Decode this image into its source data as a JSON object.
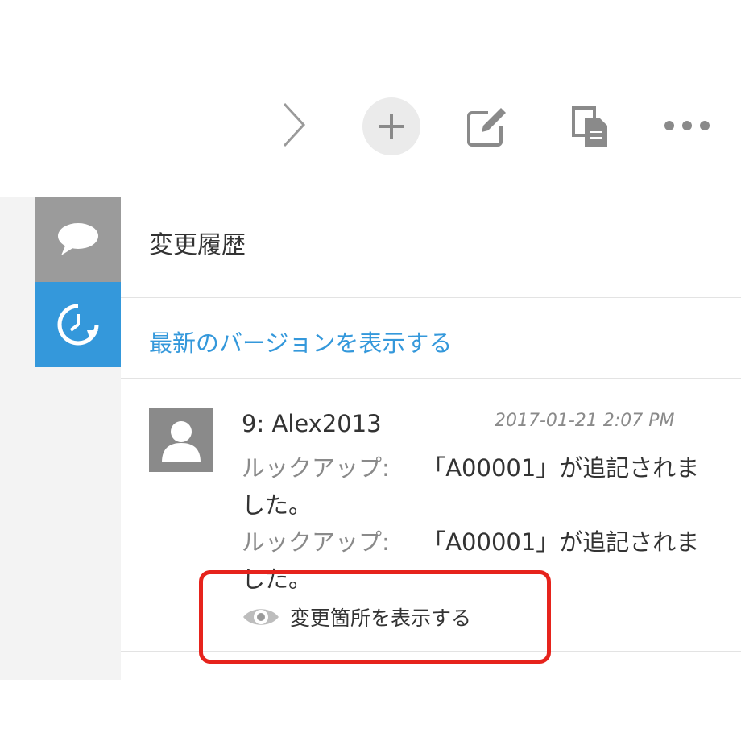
{
  "toolbar": {
    "icons": {
      "next": "chevron-right-icon",
      "add": "plus-icon",
      "edit": "edit-icon",
      "duplicate": "copy-icon",
      "more": "more-icon"
    }
  },
  "sidebar": {
    "tabs": [
      {
        "name": "comment",
        "icon": "speech-bubble-icon",
        "active": false,
        "color": "#9b9b9b"
      },
      {
        "name": "history",
        "icon": "history-icon",
        "active": true,
        "color": "#3498db"
      }
    ]
  },
  "panel": {
    "title": "変更履歴",
    "latest_link": "最新のバージョンを表示する",
    "entry": {
      "user": "9: Alex2013",
      "timestamp": "2017-01-21 2:07 PM",
      "changes": [
        {
          "label": "ルックアップ:",
          "text_line1": "「A00001」が追記されま",
          "text_line2": "した。"
        },
        {
          "label": "ルックアップ:",
          "text_line1": "「A00001」が追記されま",
          "text_line2": "した。"
        }
      ],
      "show_changes": "変更箇所を表示する"
    }
  },
  "colors": {
    "accent": "#3498db",
    "highlight": "#e6231c"
  }
}
